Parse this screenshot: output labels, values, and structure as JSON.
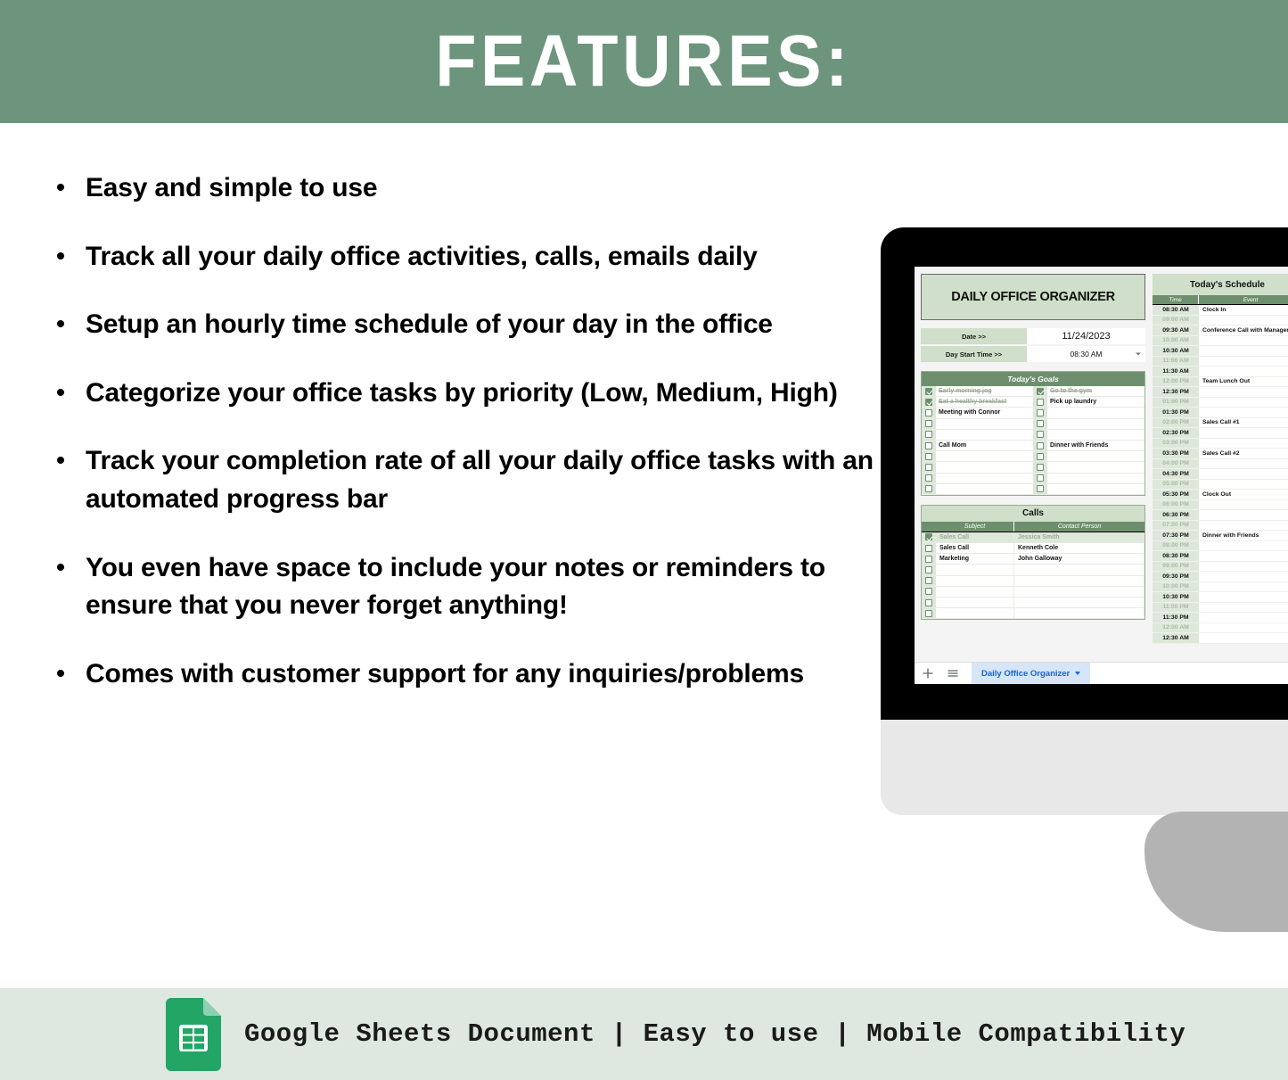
{
  "header": {
    "title": "FEATURES:",
    "background_color": "#6d947c",
    "text_color": "#ffffff"
  },
  "features": [
    "Easy and simple to use",
    "Track  all your daily office activities, calls, emails daily",
    "Setup an hourly time schedule of your day in the office",
    "Categorize your office tasks by priority (Low, Medium, High)",
    "Track your completion rate of all your daily office tasks with an automated progress bar",
    "You even have space to include your notes or reminders to ensure that you never forget anything!",
    "Comes with customer support for any inquiries/problems"
  ],
  "spreadsheet": {
    "title": "DAILY OFFICE ORGANIZER",
    "meta": [
      {
        "label": "Date >>",
        "value": "11/24/2023",
        "has_dropdown": false
      },
      {
        "label": "Day Start Time >>",
        "value": "08:30 AM",
        "has_dropdown": true
      }
    ],
    "goals": {
      "heading": "Today's Goals",
      "left_column": [
        {
          "text": "Early morning jog",
          "checked": true
        },
        {
          "text": "Eat a healthy breakfast",
          "checked": true
        },
        {
          "text": "Meeting with Connor",
          "checked": false
        },
        {
          "text": "",
          "checked": false
        },
        {
          "text": "",
          "checked": false
        },
        {
          "text": "Call Mom",
          "checked": false
        },
        {
          "text": "",
          "checked": false
        },
        {
          "text": "",
          "checked": false
        },
        {
          "text": "",
          "checked": false
        },
        {
          "text": "",
          "checked": false
        }
      ],
      "right_column": [
        {
          "text": "Go to the gym",
          "checked": true
        },
        {
          "text": "Pick up laundry",
          "checked": false
        },
        {
          "text": "",
          "checked": false
        },
        {
          "text": "",
          "checked": false
        },
        {
          "text": "",
          "checked": false
        },
        {
          "text": "Dinner with Friends",
          "checked": false
        },
        {
          "text": "",
          "checked": false
        },
        {
          "text": "",
          "checked": false
        },
        {
          "text": "",
          "checked": false
        },
        {
          "text": "",
          "checked": false
        }
      ]
    },
    "calls": {
      "heading": "Calls",
      "columns": [
        "Subject",
        "Contact Person"
      ],
      "rows": [
        {
          "subject": "Sales Call",
          "contact": "Jessica Smith",
          "checked": true
        },
        {
          "subject": "Sales Call",
          "contact": "Kenneth Cole",
          "checked": false
        },
        {
          "subject": "Marketing",
          "contact": "John Galloway",
          "checked": false
        },
        {
          "subject": "",
          "contact": "",
          "checked": false
        },
        {
          "subject": "",
          "contact": "",
          "checked": false
        },
        {
          "subject": "",
          "contact": "",
          "checked": false
        },
        {
          "subject": "",
          "contact": "",
          "checked": false
        },
        {
          "subject": "",
          "contact": "",
          "checked": false
        }
      ]
    },
    "schedule": {
      "heading": "Today's Schedule",
      "columns": [
        "Time",
        "Event"
      ],
      "rows": [
        {
          "time": "08:30 AM",
          "event": "Clock In",
          "half": false
        },
        {
          "time": "09:00 AM",
          "event": "",
          "half": true
        },
        {
          "time": "09:30 AM",
          "event": "Conference Call with Manager",
          "half": false
        },
        {
          "time": "10:00 AM",
          "event": "",
          "half": true
        },
        {
          "time": "10:30 AM",
          "event": "",
          "half": false
        },
        {
          "time": "11:00 AM",
          "event": "",
          "half": true
        },
        {
          "time": "11:30 AM",
          "event": "",
          "half": false
        },
        {
          "time": "12:00 PM",
          "event": "Team Lunch Out",
          "half": true
        },
        {
          "time": "12:30 PM",
          "event": "",
          "half": false
        },
        {
          "time": "01:00 PM",
          "event": "",
          "half": true
        },
        {
          "time": "01:30 PM",
          "event": "",
          "half": false
        },
        {
          "time": "02:00 PM",
          "event": "Sales Call #1",
          "half": true
        },
        {
          "time": "02:30 PM",
          "event": "",
          "half": false
        },
        {
          "time": "03:00 PM",
          "event": "",
          "half": true
        },
        {
          "time": "03:30 PM",
          "event": "Sales Call #2",
          "half": false
        },
        {
          "time": "04:00 PM",
          "event": "",
          "half": true
        },
        {
          "time": "04:30 PM",
          "event": "",
          "half": false
        },
        {
          "time": "05:00 PM",
          "event": "",
          "half": true
        },
        {
          "time": "05:30 PM",
          "event": "Clock Out",
          "half": false
        },
        {
          "time": "06:00 PM",
          "event": "",
          "half": true
        },
        {
          "time": "06:30 PM",
          "event": "",
          "half": false
        },
        {
          "time": "07:00 PM",
          "event": "",
          "half": true
        },
        {
          "time": "07:30 PM",
          "event": "Dinner with Friends",
          "half": false
        },
        {
          "time": "08:00 PM",
          "event": "",
          "half": true
        },
        {
          "time": "08:30 PM",
          "event": "",
          "half": false
        },
        {
          "time": "09:00 PM",
          "event": "",
          "half": true
        },
        {
          "time": "09:30 PM",
          "event": "",
          "half": false
        },
        {
          "time": "10:00 PM",
          "event": "",
          "half": true
        },
        {
          "time": "10:30 PM",
          "event": "",
          "half": false
        },
        {
          "time": "11:00 PM",
          "event": "",
          "half": true
        },
        {
          "time": "11:30 PM",
          "event": "",
          "half": false
        },
        {
          "time": "12:00 AM",
          "event": "",
          "half": true
        },
        {
          "time": "12:30 AM",
          "event": "",
          "half": false
        }
      ]
    },
    "tabbar": {
      "add_icon": "plus-icon",
      "menu_icon": "sheet-list-icon",
      "active_tab": "Daily Office Organizer"
    }
  },
  "footer": {
    "icon": "google-sheets-icon",
    "text": "Google Sheets Document  | Easy to use | Mobile Compatibility",
    "background_color": "#dfe8e0"
  }
}
